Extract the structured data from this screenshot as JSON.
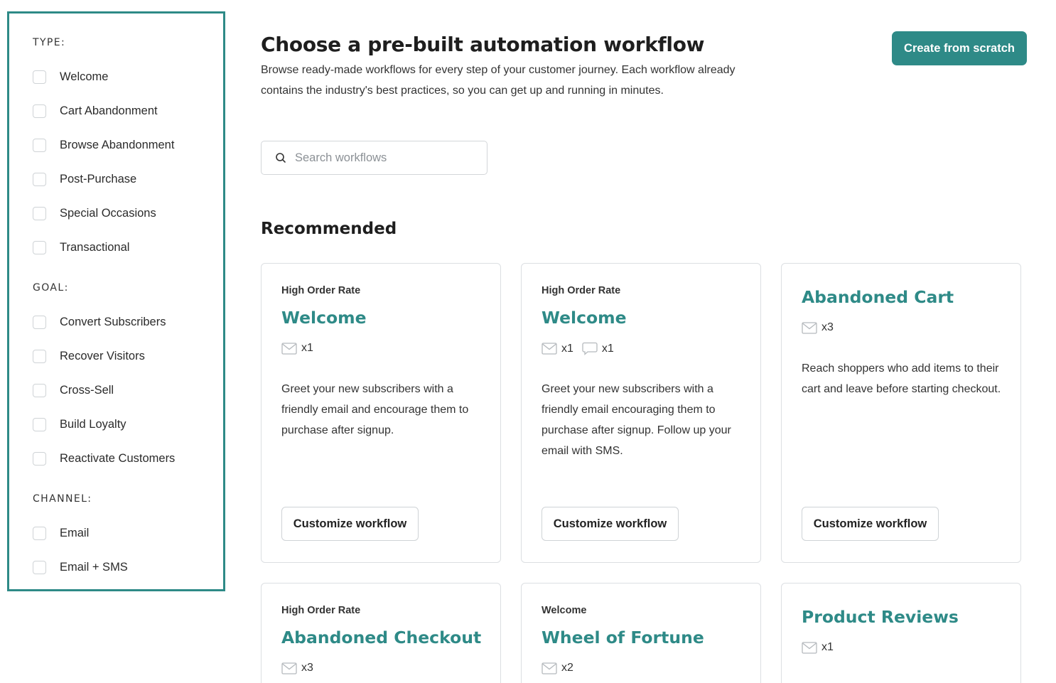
{
  "sidebar": {
    "type_title": "TYPE:",
    "type_items": [
      "Welcome",
      "Cart Abandonment",
      "Browse Abandonment",
      "Post-Purchase",
      "Special Occasions",
      "Transactional"
    ],
    "goal_title": "GOAL:",
    "goal_items": [
      "Convert Subscribers",
      "Recover Visitors",
      "Cross-Sell",
      "Build Loyalty",
      "Reactivate Customers"
    ],
    "channel_title": "CHANNEL:",
    "channel_items": [
      "Email",
      "Email + SMS"
    ]
  },
  "header": {
    "title": "Choose a pre-built automation workflow",
    "description": "Browse ready-made workflows for every step of your customer journey. Each workflow already contains the industry's best practices, so you can get up and running in minutes.",
    "create_button": "Create from scratch"
  },
  "search": {
    "placeholder": "Search workflows"
  },
  "recommended": {
    "heading": "Recommended",
    "cards": [
      {
        "tag": "High Order Rate",
        "title": "Welcome",
        "email_count": "x1",
        "sms_count": null,
        "description": "Greet your new subscribers with a friendly email and encourage them to purchase after signup.",
        "button": "Customize workflow"
      },
      {
        "tag": "High Order Rate",
        "title": "Welcome",
        "email_count": "x1",
        "sms_count": "x1",
        "description": "Greet your new subscribers with a friendly email encouraging them to purchase after signup. Follow up your email with SMS.",
        "button": "Customize workflow"
      },
      {
        "tag": null,
        "title": "Abandoned Cart",
        "email_count": "x3",
        "sms_count": null,
        "description": "Reach shoppers who add items to their cart and leave before starting checkout.",
        "button": "Customize workflow"
      },
      {
        "tag": "High Order Rate",
        "title": "Abandoned Checkout",
        "email_count": "x3",
        "sms_count": null
      },
      {
        "tag": "Welcome",
        "title": "Wheel of Fortune",
        "email_count": "x2",
        "sms_count": null
      },
      {
        "tag": null,
        "title": "Product Reviews",
        "email_count": "x1",
        "sms_count": null
      }
    ]
  },
  "icons": {
    "email": "envelope-icon",
    "sms": "chat-bubble-icon",
    "search": "search-icon"
  },
  "colors": {
    "accent": "#2e8a87",
    "border": "#dcdfe2",
    "text": "#222222"
  }
}
